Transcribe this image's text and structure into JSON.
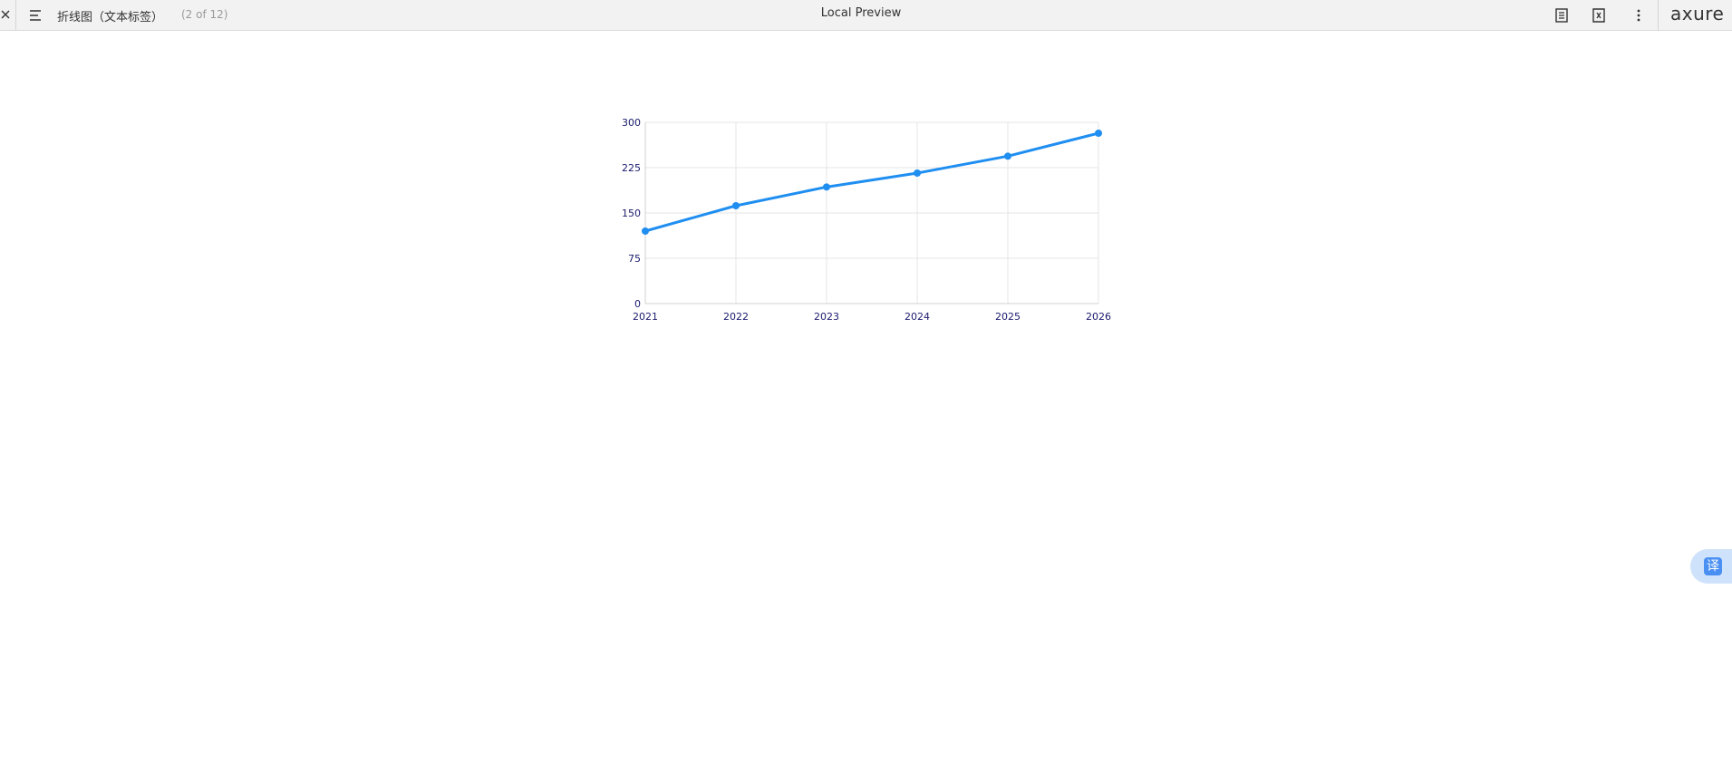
{
  "toolbar": {
    "page_title": "折线图（文本标签）",
    "page_count": "(2 of 12)",
    "center_title": "Local Preview",
    "logo": "axure",
    "icons": {
      "close": "close-icon",
      "menu": "menu-icon",
      "notes": "notes-icon",
      "inspect": "inspect-icon",
      "more": "more-vertical-icon"
    }
  },
  "chart_data": {
    "type": "line",
    "title": "",
    "xlabel": "",
    "ylabel": "",
    "categories": [
      "2021",
      "2022",
      "2023",
      "2024",
      "2025",
      "2026"
    ],
    "series": [
      {
        "values": [
          120,
          162,
          193,
          216,
          244,
          282
        ],
        "color": "#1f8ef1"
      }
    ],
    "ylim": [
      0,
      300
    ],
    "yticks": [
      "0",
      "75",
      "150",
      "225",
      "300"
    ],
    "grid": true,
    "axis_label_color": "#1a1a6e",
    "grid_color": "#e6e6e6"
  },
  "translate_button": {
    "label": "译"
  }
}
